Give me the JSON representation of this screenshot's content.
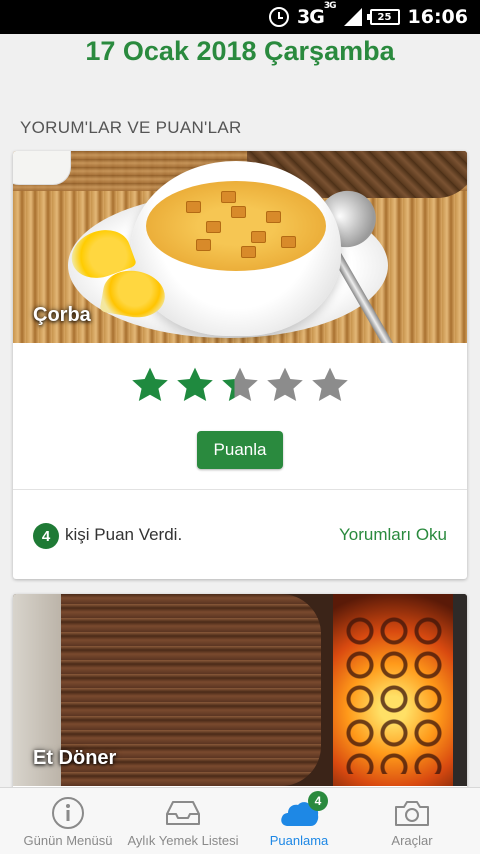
{
  "status_bar": {
    "network": "3G",
    "network_sup": "3G",
    "battery": "25",
    "time": "16:06"
  },
  "header": {
    "date": "17 Ocak 2018 Çarşamba"
  },
  "section": {
    "title": "YORUM'LAR VE PUAN'LAR"
  },
  "cards": [
    {
      "food_name": "Çorba",
      "rating": 2,
      "max_rating": 5,
      "rate_button": "Puanla",
      "voter_count": "4",
      "voter_text": "kişi Puan Verdi.",
      "read_comments": "Yorumları Oku"
    },
    {
      "food_name": "Et Döner"
    }
  ],
  "colors": {
    "accent_green": "#2a8a3e",
    "star_filled": "#1f8a3f",
    "star_empty": "#8c8c8c",
    "nav_active": "#1e88e5"
  },
  "bottom_nav": {
    "items": [
      {
        "label": "Günün Menüsü",
        "icon": "info-icon"
      },
      {
        "label": "Aylık Yemek Listesi",
        "icon": "inbox-icon"
      },
      {
        "label": "Puanlama",
        "icon": "cloud-icon",
        "badge": "4",
        "active": true
      },
      {
        "label": "Araçlar",
        "icon": "camera-icon"
      }
    ]
  }
}
